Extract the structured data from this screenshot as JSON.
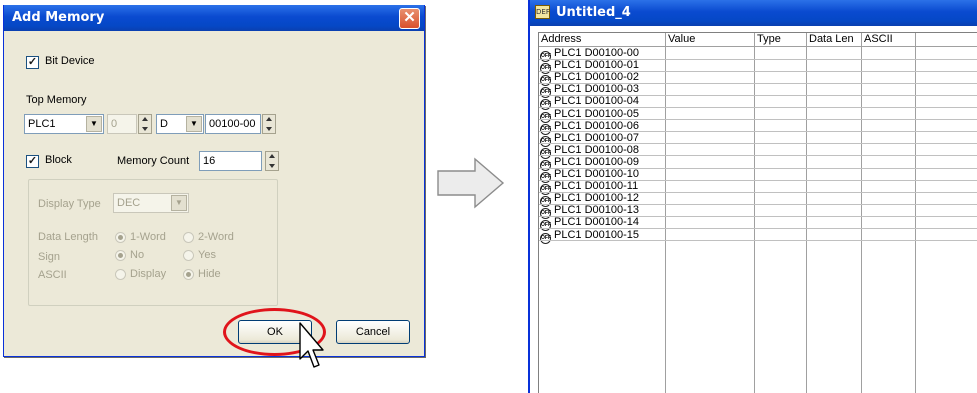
{
  "dialog": {
    "title": "Add Memory",
    "close_glyph": "✕",
    "bit_device_label": "Bit Device",
    "bit_device_checked": true,
    "top_memory_label": "Top Memory",
    "plc_select": "PLC1",
    "station_value": "0",
    "device_select": "D",
    "address_value": "00100-00",
    "block_label": "Block",
    "block_checked": true,
    "memory_count_label": "Memory Count",
    "memory_count_value": "16",
    "display_type_label": "Display Type",
    "display_type_value": "DEC",
    "data_length_label": "Data Length",
    "data_length_opt1": "1-Word",
    "data_length_opt2": "2-Word",
    "sign_label": "Sign",
    "sign_opt1": "No",
    "sign_opt2": "Yes",
    "ascii_label": "ASCII",
    "ascii_opt1": "Display",
    "ascii_opt2": "Hide",
    "ok_label": "OK",
    "cancel_label": "Cancel"
  },
  "window": {
    "title": "Untitled_4",
    "icon_text": "DEF",
    "columns": [
      "Address",
      "Value",
      "Type",
      "Data Len",
      "ASCII"
    ],
    "rows": [
      "PLC1 D00100-00",
      "PLC1 D00100-01",
      "PLC1 D00100-02",
      "PLC1 D00100-03",
      "PLC1 D00100-04",
      "PLC1 D00100-05",
      "PLC1 D00100-06",
      "PLC1 D00100-07",
      "PLC1 D00100-08",
      "PLC1 D00100-09",
      "PLC1 D00100-10",
      "PLC1 D00100-11",
      "PLC1 D00100-12",
      "PLC1 D00100-13",
      "PLC1 D00100-14",
      "PLC1 D00100-15"
    ],
    "row_icon_text": "OFF"
  },
  "colors": {
    "titlebar": "#0a4ad0",
    "highlight": "#e0141b",
    "dialog_bg": "#ece9d8"
  }
}
